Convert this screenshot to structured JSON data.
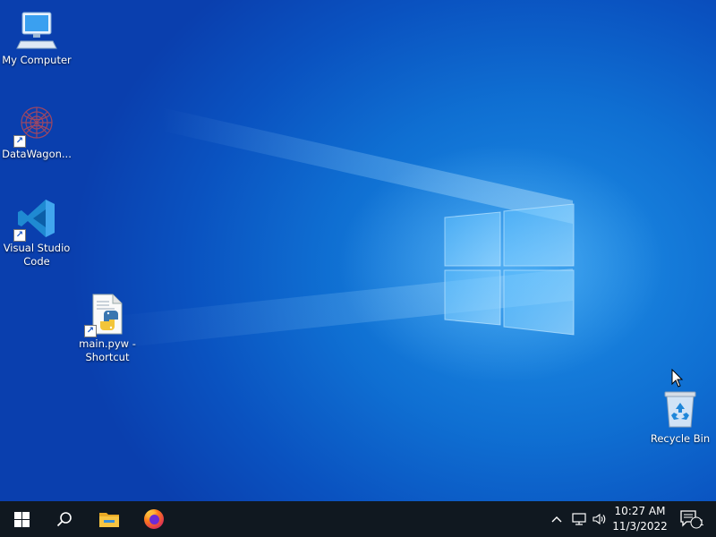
{
  "desktop": {
    "icons": [
      {
        "label": "My Computer",
        "icon": "computer-icon"
      },
      {
        "label": "DataWagon...",
        "icon": "datawagon-icon",
        "shortcut": true
      },
      {
        "label": "Visual Studio Code",
        "icon": "vscode-icon",
        "shortcut": true
      },
      {
        "label": "main.pyw - Shortcut",
        "icon": "python-file-icon",
        "shortcut": true
      },
      {
        "label": "Recycle Bin",
        "icon": "recycle-bin-icon"
      }
    ]
  },
  "taskbar": {
    "start": "windows-start-icon",
    "search": "search-icon",
    "pinned": [
      "file-explorer-icon",
      "firefox-icon"
    ],
    "tray": {
      "chevron": "chevron-up-icon",
      "network": "network-icon",
      "volume": "volume-icon",
      "time": "10:27 AM",
      "date": "11/3/2022",
      "notifications_count": "1"
    }
  },
  "colors": {
    "taskbar": "#101820",
    "desktop_accent": "#0f6fd2"
  }
}
